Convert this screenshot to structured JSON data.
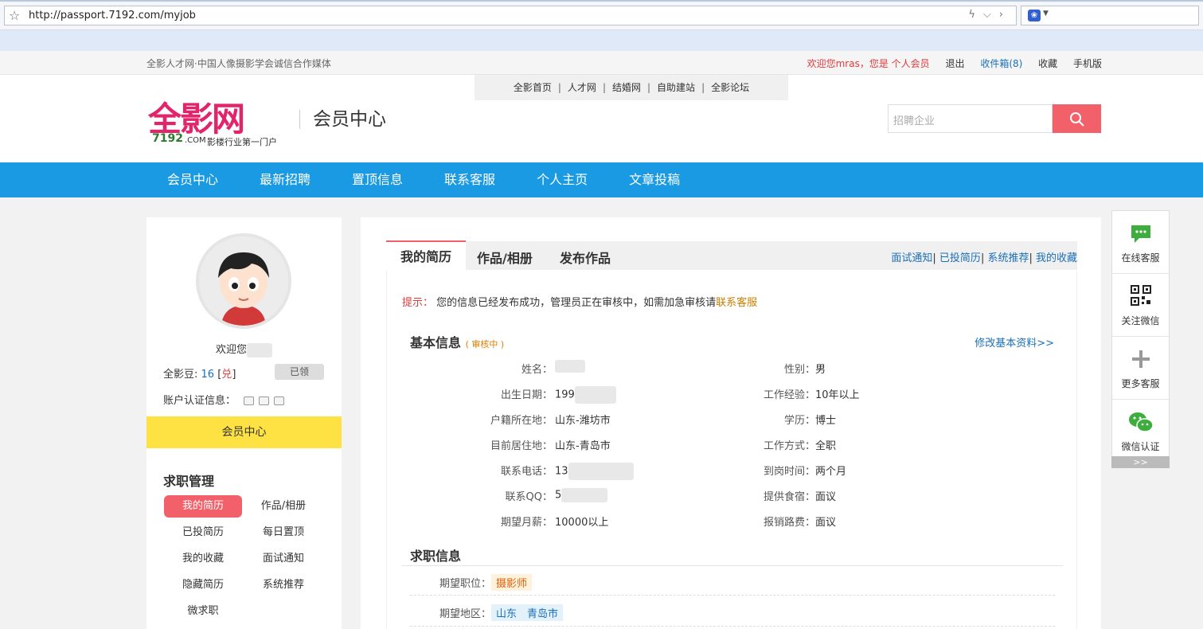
{
  "browser": {
    "url": "http://passport.7192.com/myjob"
  },
  "topbar": {
    "left_text": "全影人才网·中国人像摄影学会诚信合作媒体",
    "welcome": "欢迎您mras，您是 个人会员",
    "logout": "退出",
    "inbox": "收件箱(8)",
    "favorite": "收藏",
    "mobile": "手机版"
  },
  "subnav": [
    "全影首页",
    "人才网",
    "结婚网",
    "自助建站",
    "全影论坛"
  ],
  "logo": {
    "name": "全影网",
    "domain_num": "7192",
    "domain_com": ".COM",
    "slogan": "影楼行业第一门户"
  },
  "header": {
    "title": "会员中心",
    "search_placeholder": "招聘企业"
  },
  "main_nav": [
    "会员中心",
    "最新招聘",
    "置顶信息",
    "联系客服",
    "个人主页",
    "文章投稿"
  ],
  "sidebar": {
    "welcome": "欢迎您",
    "beans_label": "全影豆:",
    "beans_value": "16",
    "exchange": "兑",
    "claimed": "已领",
    "auth_label": "账户认证信息：",
    "member_center": "会员中心",
    "section_title": "求职管理",
    "menu": [
      "我的简历",
      "作品/相册",
      "已投简历",
      "每日置顶",
      "我的收藏",
      "面试通知",
      "隐藏简历",
      "系统推荐",
      "微求职"
    ]
  },
  "tabs": {
    "items": [
      "我的简历",
      "作品/相册",
      "发布作品"
    ],
    "links": [
      "面试通知",
      "已投简历",
      "系统推荐",
      "我的收藏"
    ]
  },
  "tip": {
    "label": "提示：",
    "text": "您的信息已经发布成功，管理员正在审核中，如需加急审核请",
    "link": "联系客服"
  },
  "basic": {
    "title": "基本信息",
    "status": "( 审核中 )",
    "edit": "修改基本资料>>",
    "left_fields": [
      {
        "label": "姓名：",
        "value": ""
      },
      {
        "label": "出生日期：",
        "value": "199"
      },
      {
        "label": "户籍所在地：",
        "value": "山东-潍坊市"
      },
      {
        "label": "目前居住地：",
        "value": "山东-青岛市"
      },
      {
        "label": "联系电话：",
        "value": "13"
      },
      {
        "label": "联系QQ：",
        "value": "5"
      },
      {
        "label": "期望月薪：",
        "value": "10000以上"
      }
    ],
    "right_fields": [
      {
        "label": "性别：",
        "value": "男"
      },
      {
        "label": "工作经验：",
        "value": "10年以上"
      },
      {
        "label": "学历：",
        "value": "博士"
      },
      {
        "label": "工作方式：",
        "value": "全职"
      },
      {
        "label": "到岗时间：",
        "value": "两个月"
      },
      {
        "label": "提供食宿：",
        "value": "面议"
      },
      {
        "label": "报销路费：",
        "value": "面议"
      }
    ]
  },
  "job": {
    "title": "求职信息",
    "position_label": "期望职位：",
    "position": "摄影师",
    "area_label": "期望地区：",
    "area": "山东　青岛市"
  },
  "float_bar": [
    "在线客服",
    "关注微信",
    "更多客服",
    "微信认证"
  ],
  "float_more": ">>",
  "colors": {
    "nav_blue": "#1a9ae2",
    "accent_red": "#f2616a",
    "member_yellow": "#fee143"
  }
}
